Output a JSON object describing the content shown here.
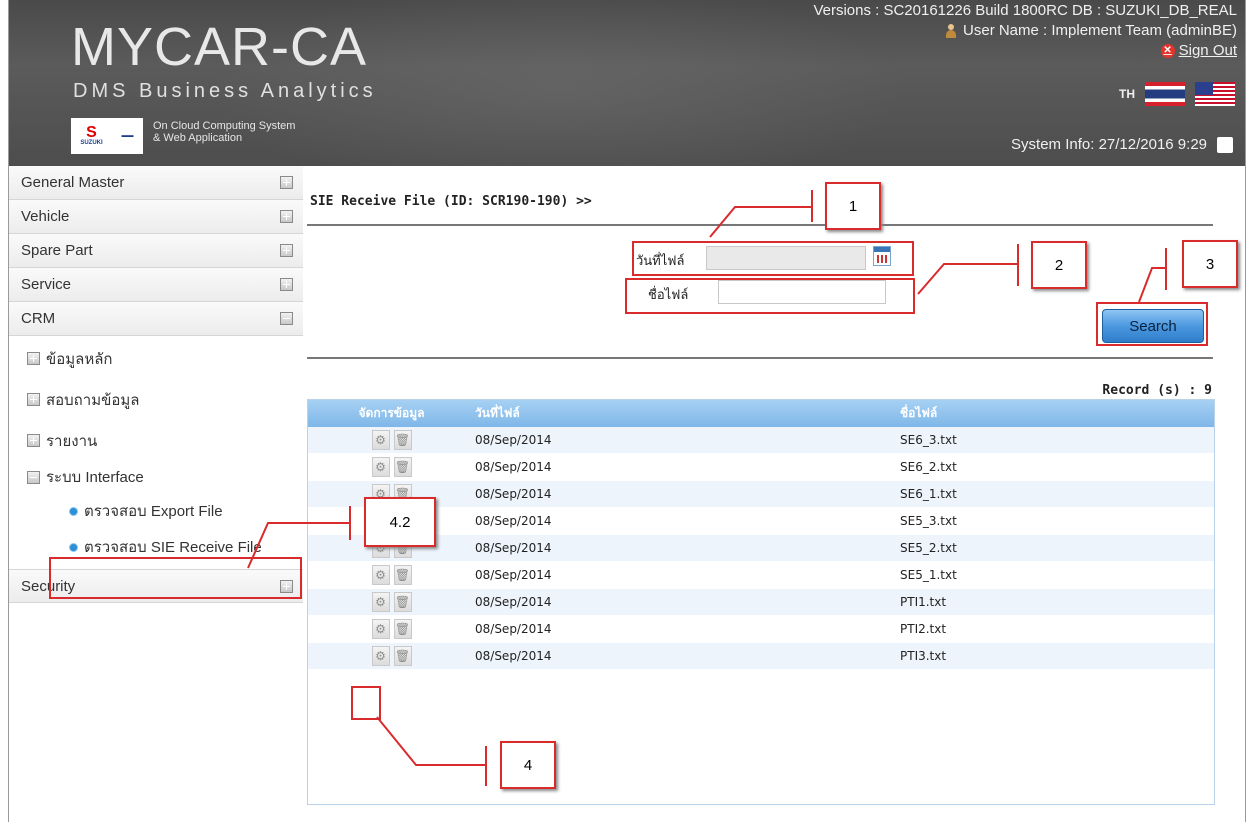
{
  "header": {
    "logo": "MYCAR-CA",
    "tagline": "DMS Business Analytics",
    "cloud_line1": "On Cloud Computing System",
    "cloud_line2": "& Web Application",
    "brand_mark": "SUZUKI",
    "versions": "Versions : SC20161226 Build 1800RC DB : SUZUKI_DB_REAL",
    "user_name": "User Name : Implement Team (adminBE)",
    "sign_out": "Sign Out",
    "lang_label": "TH",
    "system_info": "System Info: 27/12/2016 9:29"
  },
  "sidebar": {
    "items": [
      {
        "label": "General Master"
      },
      {
        "label": "Vehicle"
      },
      {
        "label": "Spare Part"
      },
      {
        "label": "Service"
      },
      {
        "label": "CRM"
      }
    ],
    "crm_sub": [
      {
        "label": "ข้อมูลหลัก"
      },
      {
        "label": "สอบถามข้อมูล"
      },
      {
        "label": "รายงาน"
      },
      {
        "label": "ระบบ Interface"
      }
    ],
    "interface_leaves": [
      {
        "label": "ตรวจสอบ Export File"
      },
      {
        "label": "ตรวจสอบ SIE Receive File"
      }
    ],
    "security": "Security"
  },
  "main": {
    "title": "SIE Receive File (ID: SCR190-190) >>",
    "file_date_label": "วันที่ไฟล์",
    "file_name_label": "ชื่อไฟล์",
    "file_date_value": "",
    "file_name_value": "",
    "search_label": "Search",
    "record_count": "Record (s) : 9"
  },
  "table": {
    "headers": [
      "จัดการข้อมูล",
      "วันที่ไฟล์",
      "ชื่อไฟล์"
    ],
    "rows": [
      {
        "date": "08/Sep/2014",
        "file": "SE6_3.txt"
      },
      {
        "date": "08/Sep/2014",
        "file": "SE6_2.txt"
      },
      {
        "date": "08/Sep/2014",
        "file": "SE6_1.txt"
      },
      {
        "date": "08/Sep/2014",
        "file": "SE5_3.txt"
      },
      {
        "date": "08/Sep/2014",
        "file": "SE5_2.txt"
      },
      {
        "date": "08/Sep/2014",
        "file": "SE5_1.txt"
      },
      {
        "date": "08/Sep/2014",
        "file": "PTI1.txt"
      },
      {
        "date": "08/Sep/2014",
        "file": "PTI2.txt"
      },
      {
        "date": "08/Sep/2014",
        "file": "PTI3.txt"
      }
    ]
  },
  "annotations": {
    "a1": "1",
    "a2": "2",
    "a3": "3",
    "a4": "4",
    "a42": "4.2"
  },
  "colors": {
    "accent": "#2f7dcb",
    "annotation": "#d92b2b",
    "header_bg": "#4d4d4d"
  }
}
